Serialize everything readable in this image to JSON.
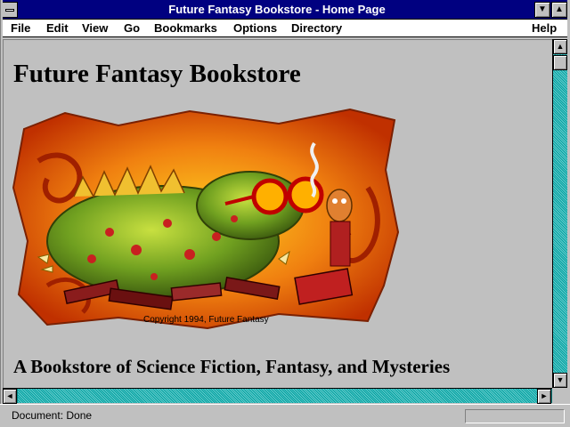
{
  "window": {
    "title": "Future Fantasy Bookstore - Home Page",
    "minimize_glyph": "▼",
    "maximize_glyph": "▲"
  },
  "menubar": {
    "items": [
      {
        "label": "File"
      },
      {
        "label": "Edit"
      },
      {
        "label": "View"
      },
      {
        "label": "Go"
      },
      {
        "label": "Bookmarks"
      },
      {
        "label": "Options"
      },
      {
        "label": "Directory"
      },
      {
        "label": "Help"
      }
    ]
  },
  "page": {
    "title": "Future Fantasy Bookstore",
    "banner_image": "dragon-reading-books-illustration",
    "banner_copyright": "Copyright 1994, Future Fantasy",
    "subtitle": "A Bookstore of Science Fiction, Fantasy, and Mysteries"
  },
  "scrollbars": {
    "up_glyph": "▲",
    "down_glyph": "▼",
    "left_glyph": "◄",
    "right_glyph": "►"
  },
  "status": {
    "text": "Document: Done"
  },
  "colors": {
    "titlebar": "#000080",
    "background": "#c0c0c0",
    "scroll_track": "#008080"
  }
}
